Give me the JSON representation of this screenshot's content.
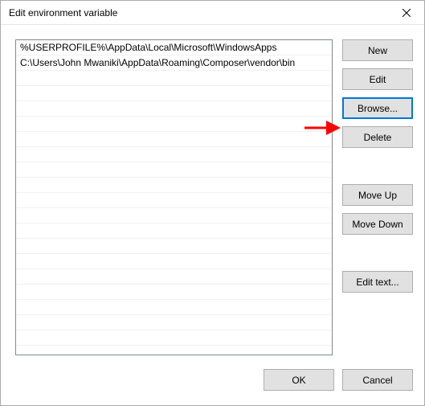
{
  "dialog": {
    "title": "Edit environment variable"
  },
  "list": {
    "items": [
      "%USERPROFILE%\\AppData\\Local\\Microsoft\\WindowsApps",
      "C:\\Users\\John Mwaniki\\AppData\\Roaming\\Composer\\vendor\\bin"
    ]
  },
  "buttons": {
    "new": "New",
    "edit": "Edit",
    "browse": "Browse...",
    "delete": "Delete",
    "moveUp": "Move Up",
    "moveDown": "Move Down",
    "editText": "Edit text...",
    "ok": "OK",
    "cancel": "Cancel"
  }
}
